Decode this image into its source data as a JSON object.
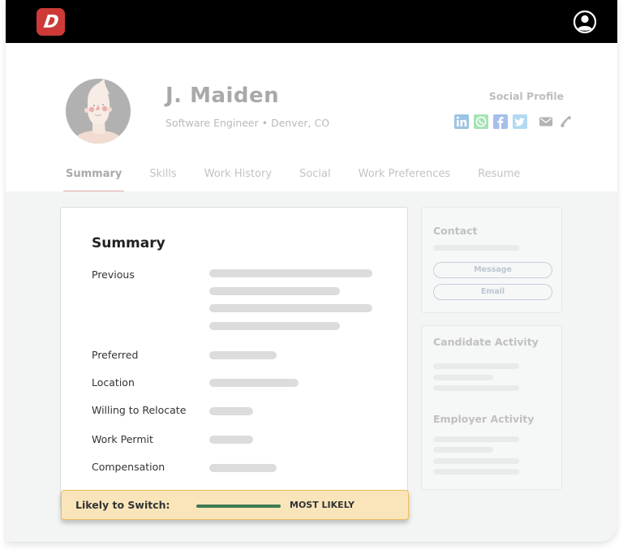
{
  "topbar": {
    "logo_letter": "D",
    "logo_color": "#cd3a37",
    "user_icon": "user-circle-icon"
  },
  "profile": {
    "name": "J. Maiden",
    "subtitle": "Software Engineer • Denver, CO",
    "avatar": "avatar-illustration",
    "social_title": "Social Profile",
    "social_icons": [
      {
        "name": "linkedin-icon",
        "color": "#9cc4e3"
      },
      {
        "name": "whatsapp-icon",
        "color": "#a6e3b5"
      },
      {
        "name": "facebook-icon",
        "color": "#a4c0ea"
      },
      {
        "name": "twitter-icon",
        "color": "#b3d9f2"
      },
      {
        "name": "mail-icon",
        "color": "#b3b3b3"
      },
      {
        "name": "phone-icon",
        "color": "#b3b3b3"
      }
    ]
  },
  "tabs": [
    {
      "label": "Summary",
      "active": true
    },
    {
      "label": "Skills",
      "active": false
    },
    {
      "label": "Work History",
      "active": false
    },
    {
      "label": "Social",
      "active": false
    },
    {
      "label": "Work Preferences",
      "active": false
    },
    {
      "label": "Resume",
      "active": false
    }
  ],
  "summary": {
    "title": "Summary",
    "rows": [
      {
        "label": "Previous"
      },
      {
        "label": "Preferred"
      },
      {
        "label": "Location"
      },
      {
        "label": "Willing to Relocate"
      },
      {
        "label": "Work Permit"
      },
      {
        "label": "Compensation"
      }
    ]
  },
  "likely_to_switch": {
    "label": "Likely to Switch:",
    "value": "MOST LIKELY",
    "fill_fraction": 1.0,
    "bar_color": "#3f7a52"
  },
  "contact": {
    "title": "Contact",
    "message_button": "Message",
    "email_button": "Email"
  },
  "activity": {
    "candidate_title": "Candidate Activity",
    "employer_title": "Employer Activity"
  },
  "colors": {
    "accent_tab_underline": "#e4a7a6",
    "switch_background": "#fae5bb",
    "switch_border": "#efbd5a"
  }
}
